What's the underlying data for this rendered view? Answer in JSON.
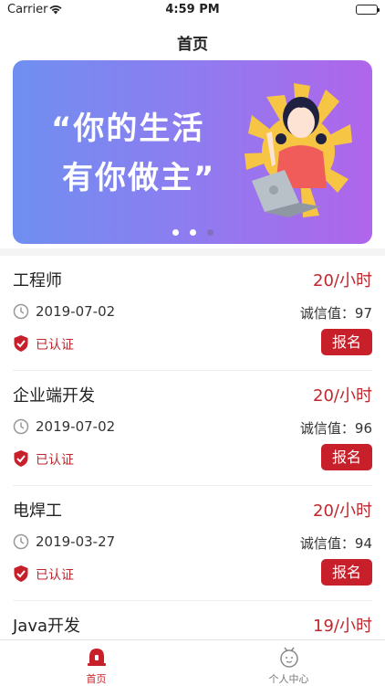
{
  "status_bar": {
    "carrier": "Carrier",
    "time": "4:59 PM"
  },
  "nav": {
    "title": "首页"
  },
  "banner": {
    "slogan_line1": "“你的生活",
    "slogan_line2": "有你做主”",
    "dots_active": 1,
    "dots_total": 3
  },
  "jobs": [
    {
      "name": "工程师",
      "wage": "20/小时",
      "date": "2019-07-02",
      "credit": "诚信值：97",
      "cert": "已认证",
      "button": "报名"
    },
    {
      "name": "企业端开发",
      "wage": "20/小时",
      "date": "2019-07-02",
      "credit": "诚信值：96",
      "cert": "已认证",
      "button": "报名"
    },
    {
      "name": "电焊工",
      "wage": "20/小时",
      "date": "2019-03-27",
      "credit": "诚信值：94",
      "cert": "已认证",
      "button": "报名"
    },
    {
      "name": "Java开发",
      "wage": "19/小时",
      "date": "",
      "credit": "",
      "cert": "",
      "button": ""
    }
  ],
  "tabs": [
    {
      "label": "首页",
      "icon": "home-siren-icon",
      "active": true
    },
    {
      "label": "个人中心",
      "icon": "profile-face-icon",
      "active": false
    }
  ],
  "colors": {
    "accent": "#c8202b",
    "banner_start": "#6f8ff0",
    "banner_end": "#b065ea"
  }
}
